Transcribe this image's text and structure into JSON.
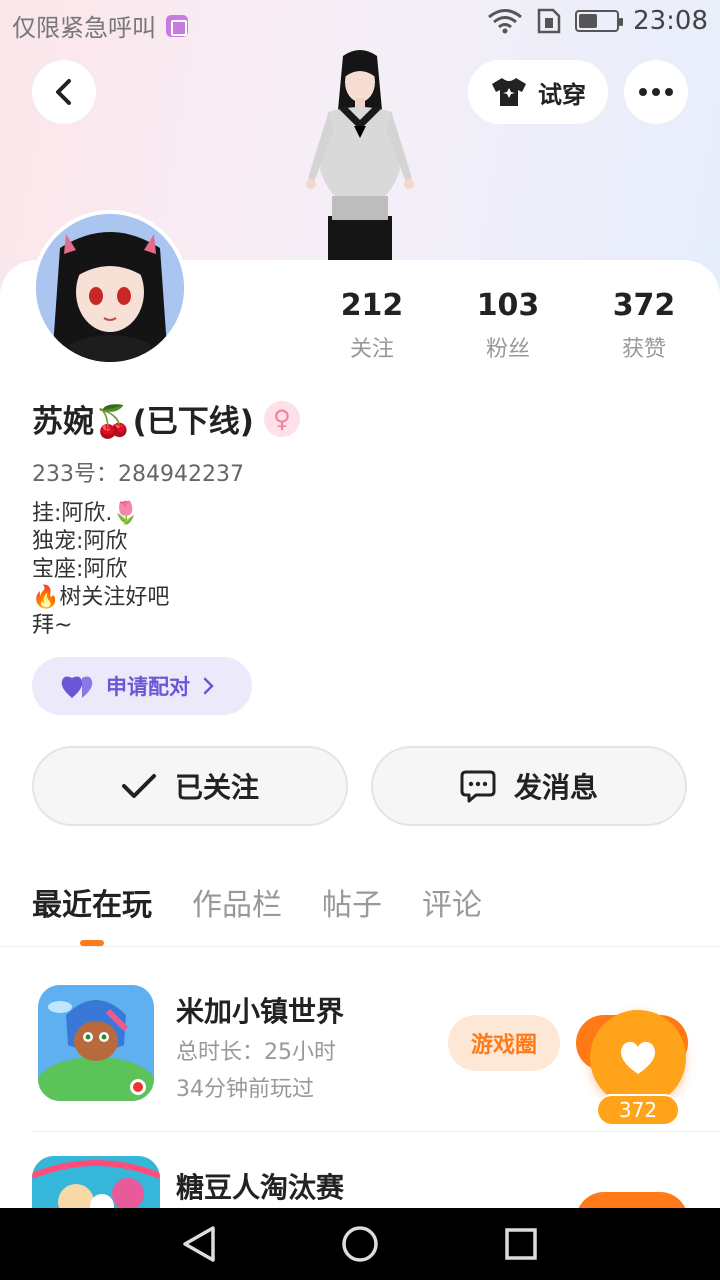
{
  "status": {
    "left_text": "仅限紧急呼叫",
    "time": "23:08"
  },
  "header": {
    "tryon_label": "试穿"
  },
  "stats": [
    {
      "value": "212",
      "label": "关注"
    },
    {
      "value": "103",
      "label": "粉丝"
    },
    {
      "value": "372",
      "label": "获赞"
    }
  ],
  "profile": {
    "name": "苏婉🍒(已下线)",
    "uid": "233号：284942237",
    "bio": [
      "挂:阿欣.🌷",
      "独宠:阿欣",
      "宝座:阿欣",
      "🔥树关注好吧",
      "拜~"
    ]
  },
  "pair": {
    "label": "申请配对"
  },
  "actions": {
    "follow_label": "已关注",
    "message_label": "发消息"
  },
  "tabs": [
    "最近在玩",
    "作品栏",
    "帖子",
    "评论"
  ],
  "games": [
    {
      "title": "米加小镇世界",
      "duration": "总时长：25小时",
      "last_played": "34分钟前玩过",
      "tag": "游戏圈"
    },
    {
      "title": "糖豆人淘汰赛"
    }
  ],
  "like": {
    "count": "372"
  },
  "icons": {
    "back": "chevron-left-icon",
    "more": "more-dots-icon",
    "tryon": "tshirt-icon",
    "pair": "heart-pair-icon",
    "follow": "check-icon",
    "message": "chat-bubble-icon",
    "like": "heart-icon",
    "gender": "female-icon"
  },
  "colors": {
    "accent": "#ff7a18",
    "pair_text": "#6b57d6",
    "like_bg": "#ffa31a"
  }
}
